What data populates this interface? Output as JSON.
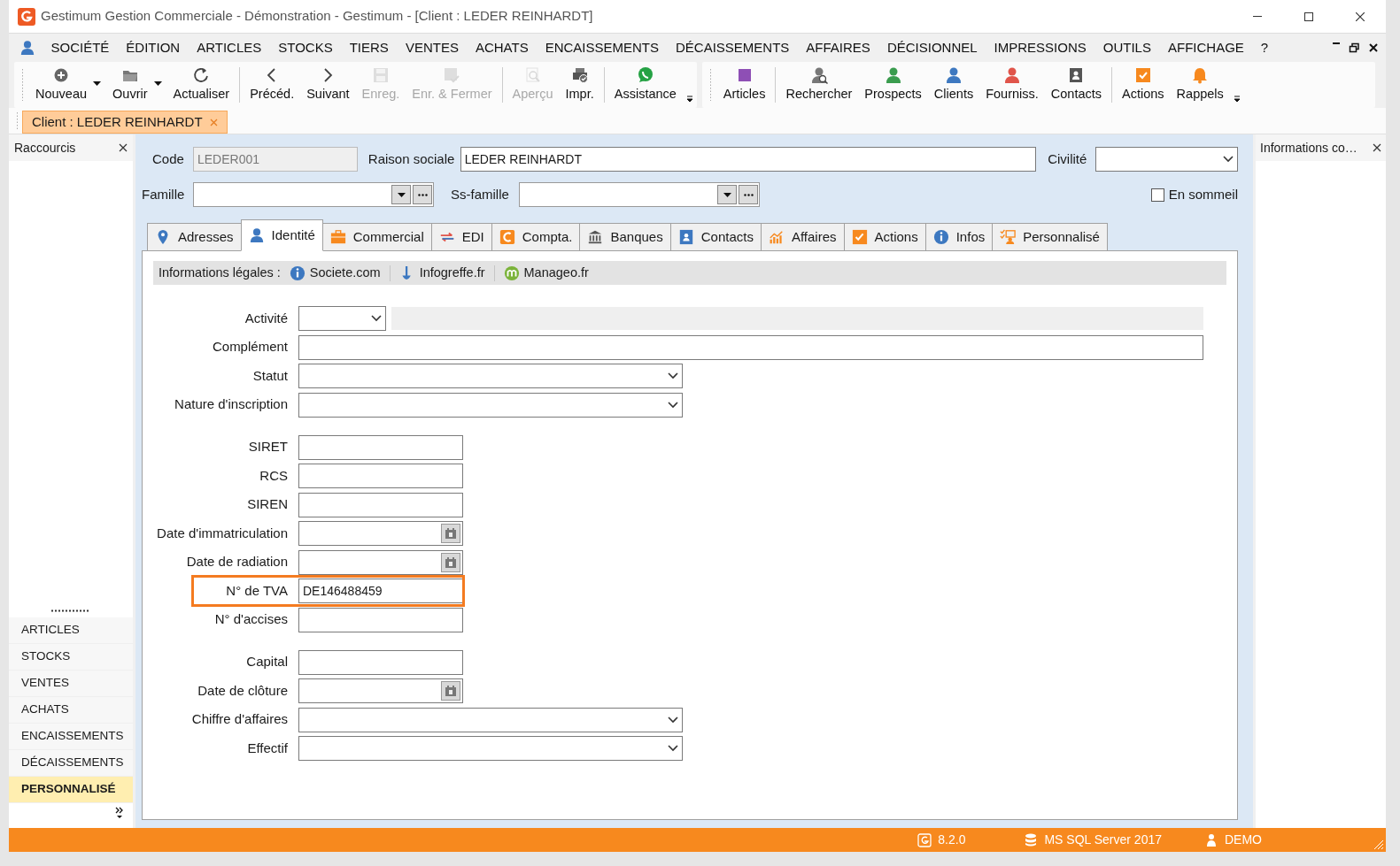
{
  "window": {
    "title": "Gestimum Gestion Commerciale - Démonstration - Gestimum - [Client : LEDER REINHARDT]"
  },
  "menu": [
    "SOCIÉTÉ",
    "ÉDITION",
    "ARTICLES",
    "STOCKS",
    "TIERS",
    "VENTES",
    "ACHATS",
    "ENCAISSEMENTS",
    "DÉCAISSEMENTS",
    "AFFAIRES",
    "DÉCISIONNEL",
    "IMPRESSIONS",
    "OUTILS",
    "AFFICHAGE",
    "?"
  ],
  "toolbar": {
    "groups": [
      [
        {
          "label": "Nouveau",
          "disabled": false,
          "dropdown": true
        },
        {
          "label": "Ouvrir",
          "disabled": false,
          "dropdown": true
        },
        {
          "label": "Actualiser",
          "disabled": false,
          "dropdown": false
        }
      ],
      [
        {
          "label": "Précéd.",
          "disabled": false,
          "dropdown": false
        },
        {
          "label": "Suivant",
          "disabled": false,
          "dropdown": false
        },
        {
          "label": "Enreg.",
          "disabled": true,
          "dropdown": false
        },
        {
          "label": "Enr. & Fermer",
          "disabled": true,
          "dropdown": false
        }
      ],
      [
        {
          "label": "Aperçu",
          "disabled": true,
          "dropdown": false
        },
        {
          "label": "Impr.",
          "disabled": false,
          "dropdown": false
        }
      ],
      [
        {
          "label": "Assistance",
          "disabled": false,
          "dropdown": false
        }
      ]
    ]
  },
  "toolbar2": {
    "groups": [
      [
        {
          "label": "Articles",
          "disabled": false,
          "dropdown": false
        }
      ],
      [
        {
          "label": "Rechercher",
          "disabled": false,
          "dropdown": false
        },
        {
          "label": "Prospects",
          "disabled": false,
          "dropdown": false
        },
        {
          "label": "Clients",
          "disabled": false,
          "dropdown": false
        },
        {
          "label": "Fourniss.",
          "disabled": false,
          "dropdown": false
        },
        {
          "label": "Contacts",
          "disabled": false,
          "dropdown": false
        }
      ],
      [
        {
          "label": "Actions",
          "disabled": false,
          "dropdown": false
        },
        {
          "label": "Rappels",
          "disabled": false,
          "dropdown": false
        }
      ]
    ]
  },
  "document_tabs": [
    {
      "label": "Client : LEDER REINHARDT",
      "selected": true
    }
  ],
  "shortcuts": {
    "title": "Raccourcis",
    "items": [
      {
        "label": "ARTICLES",
        "selected": false
      },
      {
        "label": "STOCKS",
        "selected": false
      },
      {
        "label": "VENTES",
        "selected": false
      },
      {
        "label": "ACHATS",
        "selected": false
      },
      {
        "label": "ENCAISSEMENTS",
        "selected": false
      },
      {
        "label": "DÉCAISSEMENTS",
        "selected": false
      },
      {
        "label": "PERSONNALISÉ",
        "selected": true
      }
    ]
  },
  "header_form": {
    "code": {
      "label": "Code",
      "value": "LEDER001"
    },
    "raison_sociale": {
      "label": "Raison sociale",
      "value": "LEDER REINHARDT"
    },
    "civilite": {
      "label": "Civilité"
    },
    "famille": {
      "label": "Famille"
    },
    "ss_famille": {
      "label": "Ss-famille"
    },
    "en_sommeil": {
      "label": "En sommeil",
      "checked": false
    }
  },
  "tabs": [
    {
      "label": "Adresses",
      "selected": false
    },
    {
      "label": "Identité",
      "selected": true
    },
    {
      "label": "Commercial",
      "selected": false
    },
    {
      "label": "EDI",
      "selected": false
    },
    {
      "label": "Compta.",
      "selected": false
    },
    {
      "label": "Banques",
      "selected": false
    },
    {
      "label": "Contacts",
      "selected": false
    },
    {
      "label": "Affaires",
      "selected": false
    },
    {
      "label": "Actions",
      "selected": false
    },
    {
      "label": "Infos",
      "selected": false
    },
    {
      "label": "Personnalisé",
      "selected": false
    }
  ],
  "legal_info": {
    "label": "Informations légales :",
    "links": [
      "Societe.com",
      "Infogreffe.fr",
      "Manageo.fr"
    ]
  },
  "sections": [
    [
      {
        "label": "Activité",
        "kind": "activity"
      },
      {
        "label": "Complément",
        "kind": "full"
      },
      {
        "label": "Statut",
        "kind": "select"
      },
      {
        "label": "Nature d'inscription",
        "kind": "select"
      }
    ],
    [
      {
        "label": "SIRET",
        "kind": "text"
      },
      {
        "label": "RCS",
        "kind": "text"
      },
      {
        "label": "SIREN",
        "kind": "text"
      },
      {
        "label": "Date d'immatriculation",
        "kind": "date"
      },
      {
        "label": "Date de radiation",
        "kind": "date"
      },
      {
        "label": "N° de TVA",
        "kind": "text",
        "value": "DE146488459",
        "highlighted": true
      },
      {
        "label": "N° d'accises",
        "kind": "text"
      }
    ],
    [
      {
        "label": "Capital",
        "kind": "text"
      },
      {
        "label": "Date de clôture",
        "kind": "date"
      },
      {
        "label": "Chiffre d'affaires",
        "kind": "select"
      },
      {
        "label": "Effectif",
        "kind": "select"
      }
    ]
  ],
  "info_pane": {
    "title": "Informations co…"
  },
  "status_bar": {
    "version": "8.2.0",
    "database": "MS SQL Server 2017",
    "user": "DEMO"
  }
}
